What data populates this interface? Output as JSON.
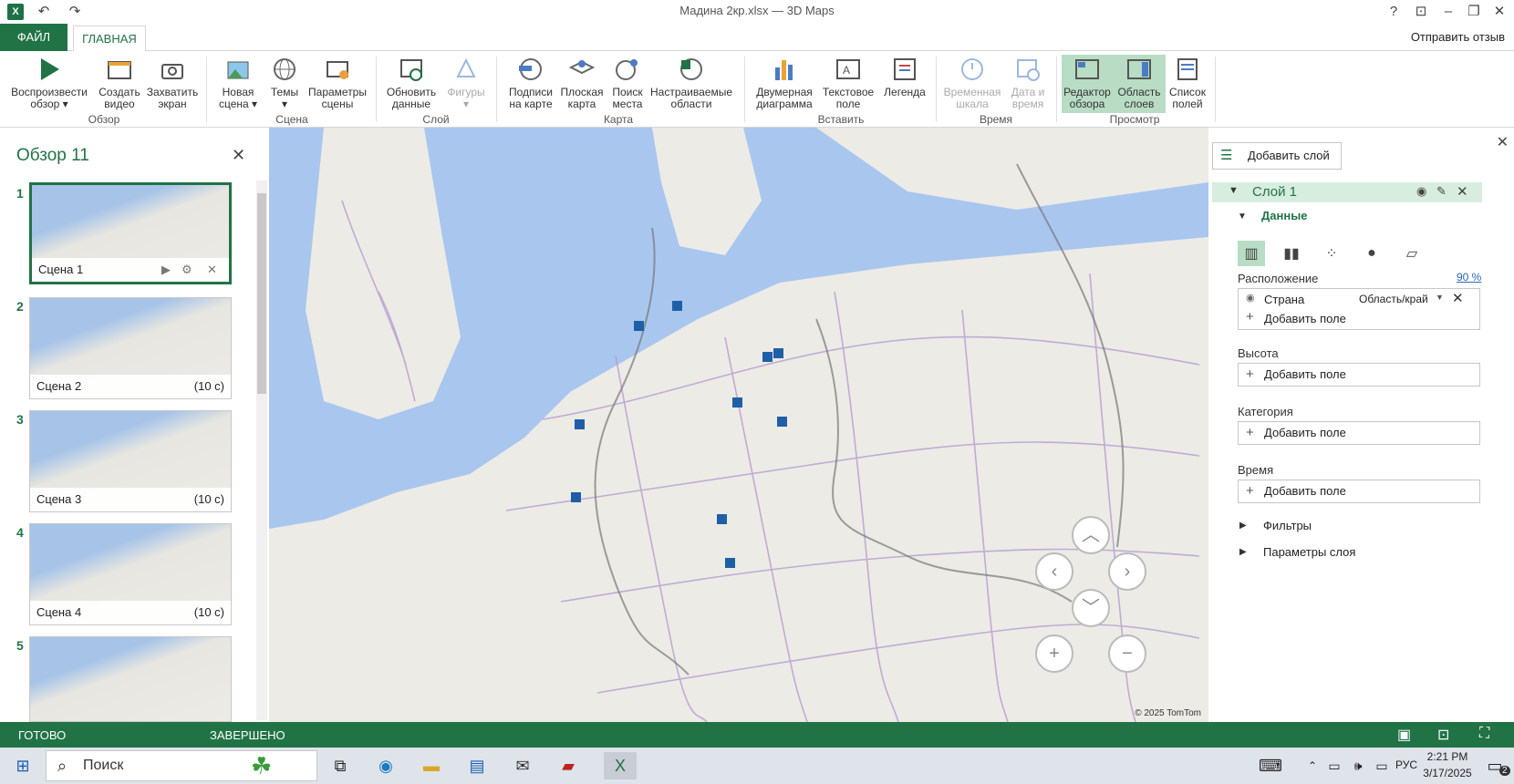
{
  "titlebar": {
    "title": "Мадина 2кр.xlsx — 3D Maps",
    "help": "?"
  },
  "tabs": {
    "file": "ФАЙЛ",
    "home": "ГЛАВНАЯ",
    "feedback": "Отправить отзыв"
  },
  "ribbon": {
    "play_tour": "Воспроизвести обзор",
    "create_video": "Создать видео",
    "capture_screen": "Захватить экран",
    "group_tour": "Обзор",
    "new_scene": "Новая сцена",
    "themes": "Темы",
    "scene_options": "Параметры сцены",
    "group_scene": "Сцена",
    "refresh_data": "Обновить данные",
    "shapes": "Фигуры",
    "group_layer": "Слой",
    "map_labels": "Подписи на карте",
    "flat_map": "Плоская карта",
    "find_location": "Поиск места",
    "custom_regions": "Настраиваемые области",
    "group_map": "Карта",
    "chart_2d": "Двумерная диаграмма",
    "text_box": "Текстовое поле",
    "legend": "Легенда",
    "group_insert": "Вставить",
    "timeline": "Временная шкала",
    "date_time": "Дата и время",
    "group_time": "Время",
    "tour_editor": "Редактор обзора",
    "layer_pane": "Область слоев",
    "field_list": "Список полей",
    "group_view": "Просмотр"
  },
  "tour": {
    "title": "Обзор 11",
    "scenes": [
      {
        "num": "1",
        "label": "Сцена 1",
        "duration": ""
      },
      {
        "num": "2",
        "label": "Сцена 2",
        "duration": "(10 с)"
      },
      {
        "num": "3",
        "label": "Сцена 3",
        "duration": "(10 с)"
      },
      {
        "num": "4",
        "label": "Сцена 4",
        "duration": "(10 с)"
      },
      {
        "num": "5",
        "label": "",
        "duration": ""
      }
    ]
  },
  "map": {
    "copyright": "© 2025 TomTom",
    "marker_color": "#1f5fa8"
  },
  "layerpane": {
    "add_layer": "Добавить слой",
    "layer_name": "Слой 1",
    "data_header": "Данные",
    "location_label": "Расположение",
    "location_pct": "90 %",
    "location_field": "Страна",
    "location_type": "Область/край",
    "add_field": "Добавить поле",
    "height_label": "Высота",
    "category_label": "Категория",
    "time_label": "Время",
    "filters": "Фильтры",
    "layer_options": "Параметры слоя"
  },
  "status": {
    "ready": "ГОТОВО",
    "done": "ЗАВЕРШЕНО"
  },
  "taskbar": {
    "search": "Поиск",
    "lang": "РУС",
    "time": "2:21 PM",
    "date": "3/17/2025",
    "notif": "2"
  },
  "colors": {
    "excel_green": "#217346",
    "selected_bg": "#b8dcc4",
    "layer_bg": "#d7eddf"
  }
}
